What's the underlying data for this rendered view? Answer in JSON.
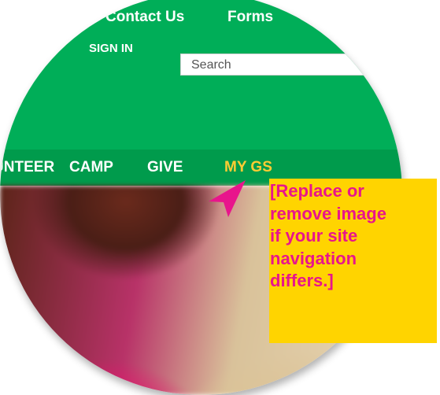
{
  "header": {
    "top_links": [
      "Contact Us",
      "Forms"
    ],
    "sign_in": "SIGN IN",
    "search_placeholder": "Search"
  },
  "nav": {
    "items": [
      "VOLUNTEER",
      "CAMP",
      "GIVE",
      "MY GS"
    ],
    "active": "MY GS"
  },
  "callout": {
    "text": "[Replace or\nremove image\nif your site\nnavigation\ndiffers.]"
  },
  "colors": {
    "header_green": "#00ae58",
    "nav_green": "#009b4c",
    "nav_active": "#ffcc33",
    "callout_bg": "#ffd400",
    "callout_text": "#e8158c",
    "arrow": "#e8158c"
  }
}
